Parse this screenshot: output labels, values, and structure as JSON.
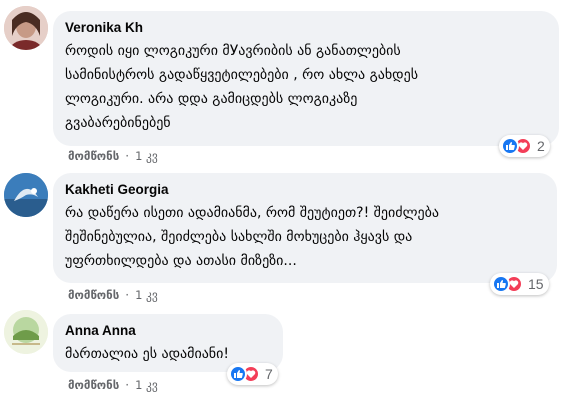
{
  "comments": [
    {
      "author": "Veronika Kh",
      "text": "როდის იყი ლოგიკური მУავრიბის ან განათლების\nსამინისტროს გადაწყვეტილებები , რო ახლა გახდეს\nლოგიკური. არა დდა გამიცდებს ლოგიკაზე\nგვაბარებინებენ",
      "reaction_count": "2",
      "like_label": "მომწონს",
      "time": "1 კვ"
    },
    {
      "author": "Kakheti Georgia",
      "text": "რა დაწერა ისეთი ადამიანმა, რომ შეუტიეთ?! შეიძლება\nშეშინებულია, შეიძლება სახლში მოხუცები ჰყავს და\nუფრთხილდება და ათასი მიზეზი...",
      "reaction_count": "15",
      "like_label": "მომწონს",
      "time": "1 კვ"
    },
    {
      "author": "Anna Anna",
      "text": "მართალია ეს ადამიანი!",
      "reaction_count": "7",
      "like_label": "მომწონს",
      "time": "1 კვ"
    }
  ],
  "colors": {
    "bubble": "#f0f2f5",
    "like": "#1877f2",
    "love": "#f33e58",
    "muted": "#65676b"
  },
  "icons": [
    "like-reaction-icon",
    "love-reaction-icon"
  ]
}
